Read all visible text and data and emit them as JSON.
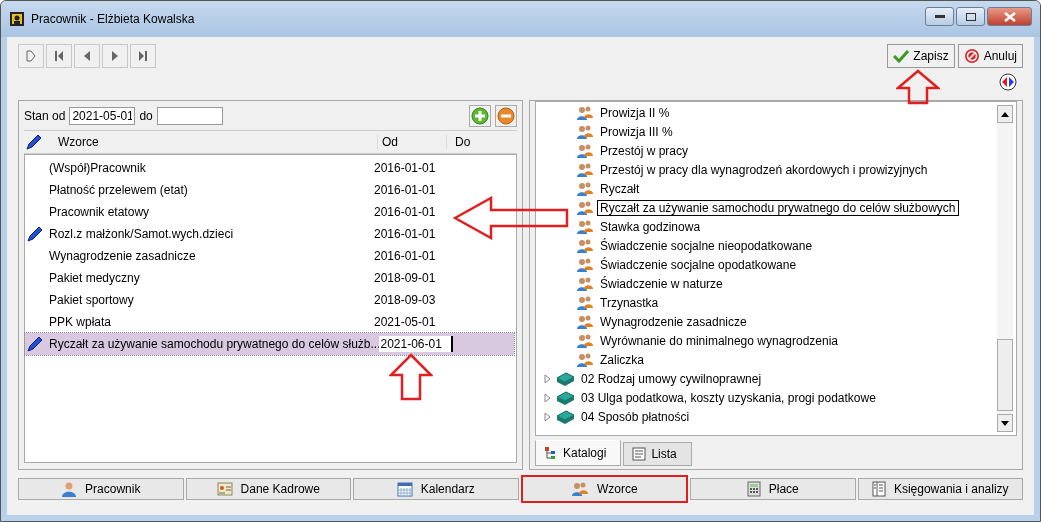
{
  "window": {
    "title": "Pracownik - Elżbieta Kowalska"
  },
  "actions": [
    {
      "label": "Zapisz",
      "kind": "save"
    },
    {
      "label": "Anuluj",
      "kind": "cancel"
    }
  ],
  "filter": {
    "from_label": "Stan od",
    "from_value": "2021-05-01",
    "to_label": "do"
  },
  "table": {
    "columns": [
      "Wzorce",
      "Od",
      "Do"
    ],
    "rows": [
      {
        "name": "(Współ)Pracownik",
        "from": "2016-01-01",
        "edited": false,
        "selected": false
      },
      {
        "name": "Płatność przelewem (etat)",
        "from": "2016-01-01",
        "edited": false,
        "selected": false
      },
      {
        "name": "Pracownik etatowy",
        "from": "2016-01-01",
        "edited": false,
        "selected": false
      },
      {
        "name": "Rozl.z małżonk/Samot.wych.dzieci",
        "from": "2016-01-01",
        "edited": true,
        "selected": false
      },
      {
        "name": "Wynagrodzenie zasadnicze",
        "from": "2016-01-01",
        "edited": false,
        "selected": false
      },
      {
        "name": "Pakiet medyczny",
        "from": "2018-09-01",
        "edited": false,
        "selected": false
      },
      {
        "name": "Pakiet sportowy",
        "from": "2018-09-03",
        "edited": false,
        "selected": false
      },
      {
        "name": "PPK wpłata",
        "from": "2021-05-01",
        "edited": false,
        "selected": false
      },
      {
        "name": "Ryczałt za używanie samochodu prywatnego do celów służb...",
        "from": "2021-06-01",
        "edited": true,
        "selected": true
      }
    ]
  },
  "tree": {
    "items": [
      {
        "label": "Prowizja II %",
        "kind": "leaf",
        "selected": false
      },
      {
        "label": "Prowizja III %",
        "kind": "leaf",
        "selected": false
      },
      {
        "label": "Przestój w pracy",
        "kind": "leaf",
        "selected": false
      },
      {
        "label": "Przestój w pracy dla wynagrodzeń akordowych i prowizyjnych",
        "kind": "leaf",
        "selected": false
      },
      {
        "label": "Ryczałt",
        "kind": "leaf",
        "selected": false
      },
      {
        "label": "Ryczałt za używanie samochodu prywatnego do celów służbowych",
        "kind": "leaf",
        "selected": true
      },
      {
        "label": "Stawka godzinowa",
        "kind": "leaf",
        "selected": false
      },
      {
        "label": "Świadczenie socjalne nieopodatkowane",
        "kind": "leaf",
        "selected": false
      },
      {
        "label": "Świadczenie socjalne opodatkowane",
        "kind": "leaf",
        "selected": false
      },
      {
        "label": "Świadczenie w naturze",
        "kind": "leaf",
        "selected": false
      },
      {
        "label": "Trzynastka",
        "kind": "leaf",
        "selected": false
      },
      {
        "label": "Wynagrodzenie zasadnicze",
        "kind": "leaf",
        "selected": false
      },
      {
        "label": "Wyrównanie do minimalnego wynagrodzenia",
        "kind": "leaf",
        "selected": false
      },
      {
        "label": "Zaliczka",
        "kind": "leaf",
        "selected": false
      },
      {
        "label": "02 Rodzaj umowy cywilnoprawnej",
        "kind": "group",
        "expanded": false,
        "selected": false
      },
      {
        "label": "03 Ulga podatkowa, koszty uzyskania, progi podatkowe",
        "kind": "group",
        "expanded": false,
        "selected": false
      },
      {
        "label": "04 Sposób płatności",
        "kind": "group",
        "expanded": false,
        "selected": false
      }
    ]
  },
  "tree_tabs": [
    {
      "label": "Katalogi",
      "kind": "tree",
      "selected": true
    },
    {
      "label": "Lista",
      "kind": "list",
      "selected": false
    }
  ],
  "sections": [
    {
      "label": "Pracownik",
      "kind": "person",
      "selected": false
    },
    {
      "label": "Dane Kadrowe",
      "kind": "card",
      "selected": false
    },
    {
      "label": "Kalendarz",
      "kind": "calendar",
      "selected": false
    },
    {
      "label": "Wzorce",
      "kind": "people",
      "selected": true
    },
    {
      "label": "Płace",
      "kind": "calc",
      "selected": false
    },
    {
      "label": "Księgowania i analizy",
      "kind": "ledger",
      "selected": false
    }
  ]
}
